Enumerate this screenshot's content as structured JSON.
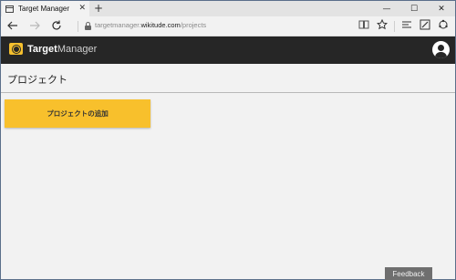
{
  "browser": {
    "tab_title": "Target Manager",
    "tab_close": "✕",
    "new_tab": "+",
    "window_controls": {
      "minimize": "—",
      "maximize": "☐",
      "close": "✕"
    },
    "url": {
      "prefix": "targetmanager.",
      "host": "wikitude.com",
      "path": "/projects"
    },
    "icons": [
      "back-icon",
      "forward-icon",
      "refresh-icon",
      "lock-icon",
      "reading-view-icon",
      "favorite-star-icon",
      "hub-icon",
      "web-note-icon",
      "share-icon"
    ]
  },
  "app": {
    "brand_bold": "Target",
    "brand_regular": "Manager",
    "accent_color": "#f8c02c",
    "header_bg": "#262626"
  },
  "page": {
    "title": "プロジェクト",
    "add_project_label": "プロジェクトの追加"
  },
  "feedback_label": "Feedback"
}
